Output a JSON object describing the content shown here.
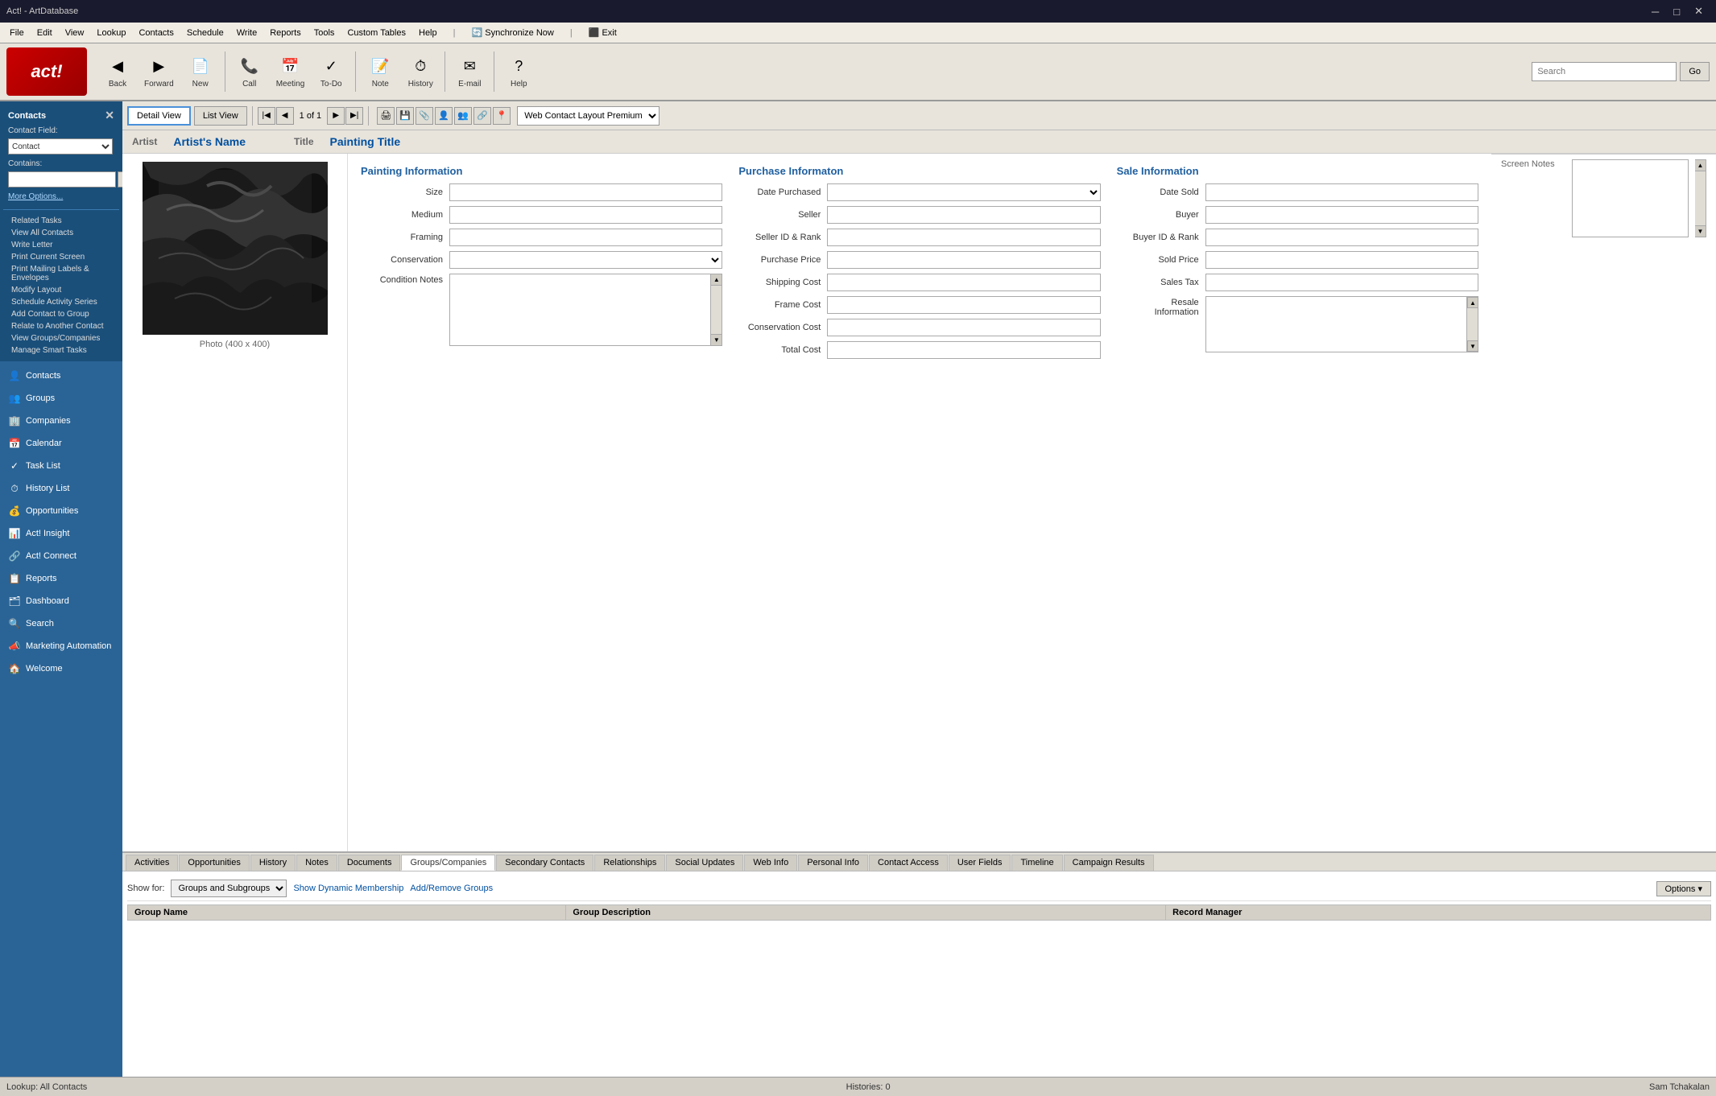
{
  "app": {
    "title": "Act! - ArtDatabase",
    "window_controls": {
      "minimize": "─",
      "restore": "□",
      "close": "✕"
    }
  },
  "menubar": {
    "items": [
      "File",
      "Edit",
      "View",
      "Lookup",
      "Contacts",
      "Schedule",
      "Write",
      "Reports",
      "Tools",
      "Custom Tables",
      "Help",
      "Synchronize Now",
      "Exit"
    ]
  },
  "toolbar": {
    "logo": "act!",
    "buttons": [
      {
        "label": "Back",
        "icon": "◀"
      },
      {
        "label": "Forward",
        "icon": "▶"
      },
      {
        "label": "New",
        "icon": "📄"
      },
      {
        "label": "Call",
        "icon": "📞"
      },
      {
        "label": "Meeting",
        "icon": "📅"
      },
      {
        "label": "To-Do",
        "icon": "✓"
      },
      {
        "label": "Note",
        "icon": "📝"
      },
      {
        "label": "History",
        "icon": "⏱"
      },
      {
        "label": "E-mail",
        "icon": "✉"
      },
      {
        "label": "Help",
        "icon": "?"
      }
    ],
    "search_placeholder": "Search",
    "search_btn": "Go"
  },
  "sidebar": {
    "section_title": "Contacts",
    "contact_field_label": "Contact Field:",
    "contact_field_options": [
      "Contact"
    ],
    "contact_field_value": "Contact",
    "contains_label": "Contains:",
    "more_options": "More Options...",
    "related_tasks": [
      "Related Tasks",
      "View All Contacts",
      "Write Letter",
      "Print Current Screen",
      "Print Mailing Labels & Envelopes",
      "Modify Layout",
      "Schedule Activity Series",
      "Add Contact to Group",
      "Relate to Another Contact",
      "View Groups/Companies",
      "Manage Smart Tasks"
    ],
    "nav_items": [
      {
        "label": "Contacts",
        "icon": "👤"
      },
      {
        "label": "Groups",
        "icon": "👥"
      },
      {
        "label": "Companies",
        "icon": "🏢"
      },
      {
        "label": "Calendar",
        "icon": "📅"
      },
      {
        "label": "Task List",
        "icon": "✓"
      },
      {
        "label": "History List",
        "icon": "⏱"
      },
      {
        "label": "Opportunities",
        "icon": "💰"
      },
      {
        "label": "Act! Insight",
        "icon": "📊"
      },
      {
        "label": "Act! Connect",
        "icon": "🔗"
      },
      {
        "label": "Reports",
        "icon": "📋"
      },
      {
        "label": "Dashboard",
        "icon": "🗂"
      },
      {
        "label": "Search",
        "icon": "🔍"
      },
      {
        "label": "Marketing Automation",
        "icon": "📣"
      },
      {
        "label": "Welcome",
        "icon": "🏠"
      }
    ]
  },
  "record_toolbar": {
    "detail_view": "Detail View",
    "list_view": "List View",
    "record_count": "1 of 1",
    "layout_label": "Web Contact Layout Premium",
    "layout_options": [
      "Web Contact Layout Premium"
    ]
  },
  "record": {
    "artist_label": "Artist",
    "artist_name": "Artist's Name",
    "title_label": "Title",
    "title_value": "Painting Title",
    "photo_label": "Photo (400 x 400)",
    "painting_info_heading": "Painting Information",
    "purchase_info_heading": "Purchase Informaton",
    "sale_info_heading": "Sale Information",
    "painting_fields": [
      {
        "label": "Size",
        "type": "input",
        "value": ""
      },
      {
        "label": "Medium",
        "type": "input",
        "value": ""
      },
      {
        "label": "Framing",
        "type": "input",
        "value": ""
      },
      {
        "label": "Conservation",
        "type": "select",
        "value": ""
      },
      {
        "label": "Condition Notes",
        "type": "textarea",
        "value": ""
      }
    ],
    "purchase_fields": [
      {
        "label": "Date Purchased",
        "type": "select",
        "value": ""
      },
      {
        "label": "Seller",
        "type": "input",
        "value": ""
      },
      {
        "label": "Seller ID & Rank",
        "type": "input",
        "value": ""
      },
      {
        "label": "Purchase Price",
        "type": "input",
        "value": ""
      },
      {
        "label": "Shipping Cost",
        "type": "input",
        "value": ""
      },
      {
        "label": "Frame Cost",
        "type": "input",
        "value": ""
      },
      {
        "label": "Conservation Cost",
        "type": "input",
        "value": ""
      },
      {
        "label": "Total Cost",
        "type": "input",
        "value": ""
      }
    ],
    "sale_fields": [
      {
        "label": "Date Sold",
        "type": "input",
        "value": ""
      },
      {
        "label": "Buyer",
        "type": "input",
        "value": ""
      },
      {
        "label": "Buyer ID & Rank",
        "type": "input",
        "value": ""
      },
      {
        "label": "Sold Price",
        "type": "input",
        "value": ""
      },
      {
        "label": "Sales Tax",
        "type": "input",
        "value": ""
      },
      {
        "label": "Resale Information",
        "type": "textarea",
        "value": ""
      }
    ],
    "screen_notes_label": "Screen Notes"
  },
  "bottom_tabs": {
    "tabs": [
      "Activities",
      "Opportunities",
      "History",
      "Notes",
      "Documents",
      "Groups/Companies",
      "Secondary Contacts",
      "Relationships",
      "Social Updates",
      "Web Info",
      "Personal Info",
      "Contact Access",
      "User Fields",
      "Timeline",
      "Campaign Results"
    ],
    "active_tab": "Groups/Companies",
    "groups": {
      "show_for_label": "Show for:",
      "show_for_value": "Groups and Subgroups",
      "show_for_options": [
        "Groups and Subgroups"
      ],
      "dynamic_label": "Show Dynamic Membership",
      "add_remove_label": "Add/Remove Groups",
      "options_label": "Options ▾",
      "columns": [
        "Group Name",
        "Group Description",
        "Record Manager"
      ]
    }
  },
  "statusbar": {
    "lookup": "Lookup: All Contacts",
    "histories": "Histories: 0",
    "user": "Sam Tchakalan"
  }
}
